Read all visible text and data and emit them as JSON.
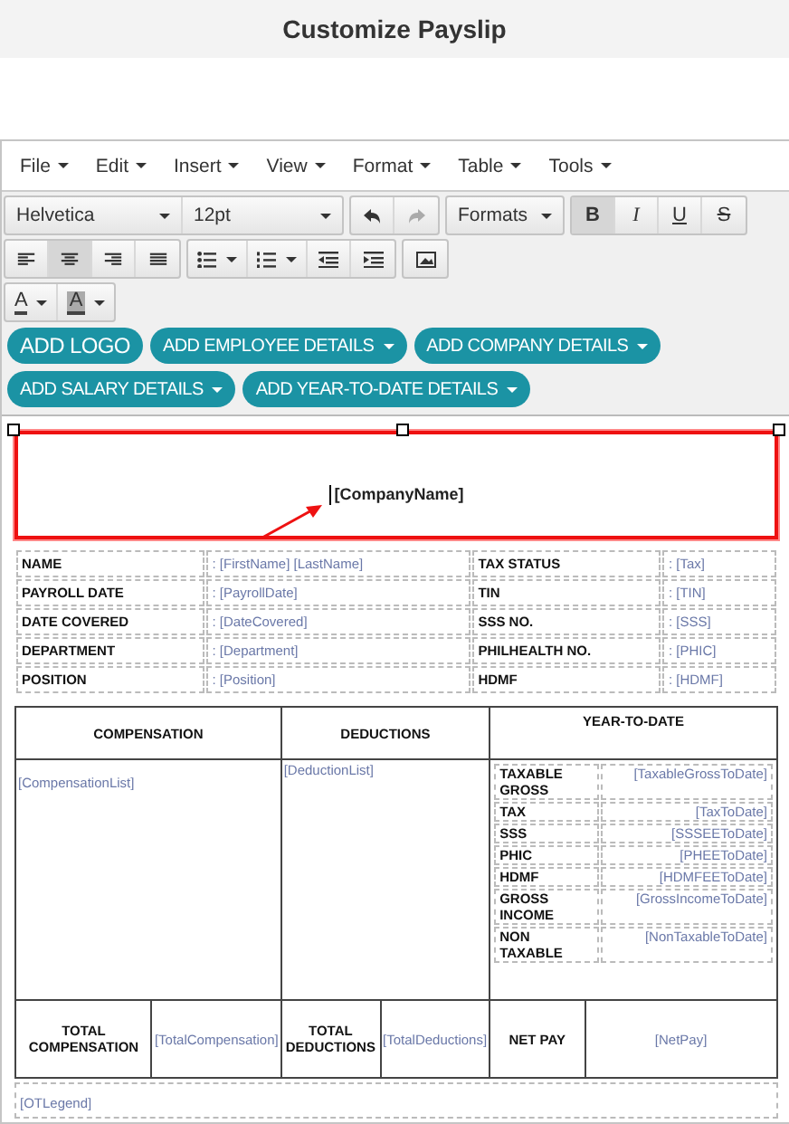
{
  "title": "Customize Payslip",
  "menu": [
    {
      "label": "File"
    },
    {
      "label": "Edit"
    },
    {
      "label": "Insert"
    },
    {
      "label": "View"
    },
    {
      "label": "Format"
    },
    {
      "label": "Table"
    },
    {
      "label": "Tools"
    }
  ],
  "font_family": "Helvetica",
  "font_size": "12pt",
  "formats": "Formats",
  "text_styles": [
    {
      "kind": "bold",
      "label": "B",
      "active": true
    },
    {
      "kind": "italic",
      "label": "I",
      "active": false
    },
    {
      "kind": "underline",
      "label": "U",
      "active": false
    },
    {
      "kind": "strike",
      "label": "S",
      "active": false
    }
  ],
  "alignments": [
    {
      "kind": "left",
      "active": false
    },
    {
      "kind": "center",
      "active": true
    },
    {
      "kind": "right",
      "active": false
    },
    {
      "kind": "justify",
      "active": false
    }
  ],
  "color_buttons": [
    {
      "kind": "text",
      "label": "A"
    },
    {
      "kind": "background",
      "label": "A"
    }
  ],
  "insert_buttons": [
    {
      "label": "ADD LOGO",
      "dropdown": false
    },
    {
      "label": "ADD EMPLOYEE DETAILS",
      "dropdown": true
    },
    {
      "label": "ADD COMPANY DETAILS",
      "dropdown": true
    },
    {
      "label": "ADD SALARY DETAILS",
      "dropdown": true
    },
    {
      "label": "ADD YEAR-TO-DATE DETAILS",
      "dropdown": true
    }
  ],
  "document": {
    "company_name": "[CompanyName]",
    "header_selected": true,
    "employee_rows": [
      {
        "label": "NAME",
        "value": ": [FirstName] [LastName]",
        "label_2": "TAX STATUS",
        "value_2": ": [Tax]"
      },
      {
        "label": "PAYROLL DATE",
        "value": ": [PayrollDate]",
        "label_2": "TIN",
        "value_2": ": [TIN]"
      },
      {
        "label": "DATE COVERED",
        "value": ": [DateCovered]",
        "label_2": "SSS NO.",
        "value_2": ": [SSS]"
      },
      {
        "label": "DEPARTMENT",
        "value": ": [Department]",
        "label_2": "PHILHEALTH NO.",
        "value_2": ": [PHIC]"
      },
      {
        "label": "POSITION",
        "value": ": [Position]",
        "label_2": "HDMF",
        "value_2": ": [HDMF]"
      }
    ],
    "headings": [
      "COMPENSATION",
      "DEDUCTIONS",
      "YEAR-TO-DATE"
    ],
    "compensation_list": "[CompensationList]",
    "deduction_list": "[DeductionList]",
    "ytd_rows": [
      {
        "label": "TAXABLE GROSS",
        "value": "[TaxableGrossToDate]"
      },
      {
        "label": "TAX",
        "value": "[TaxToDate]"
      },
      {
        "label": "SSS",
        "value": "[SSSEEToDate]"
      },
      {
        "label": "PHIC",
        "value": "[PHEEToDate]"
      },
      {
        "label": "HDMF",
        "value": "[HDMFEEToDate]"
      },
      {
        "label": "GROSS INCOME",
        "value": "[GrossIncomeToDate]"
      },
      {
        "label": "NON TAXABLE",
        "value": "[NonTaxableToDate]"
      }
    ],
    "totals": [
      {
        "label": "TOTAL COMPENSATION",
        "value": "[TotalCompensation]"
      },
      {
        "label": "TOTAL DEDUCTIONS",
        "value": "[TotalDeductions]"
      },
      {
        "label": "NET PAY",
        "value": "[NetPay]"
      }
    ],
    "legend": "[OTLegend]"
  }
}
